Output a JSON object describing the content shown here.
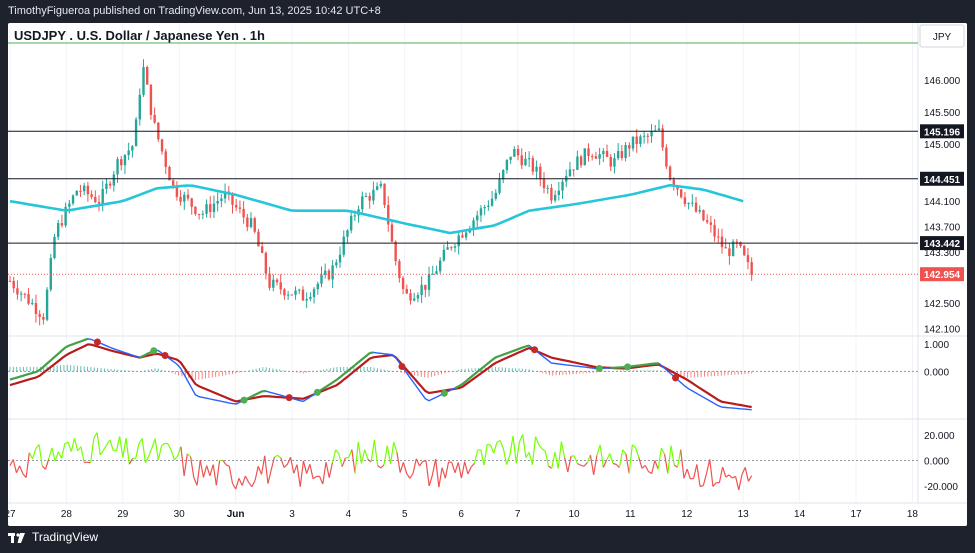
{
  "header": {
    "publisher": "TimothyFigueroa published on TradingView.com, Jun 13, 2025 10:42 UTC+8",
    "symbol_title": "USDJPY . U.S. Dollar / Japanese Yen . 1h",
    "currency": "JPY"
  },
  "footer": {
    "brand": "TradingView"
  },
  "colors": {
    "up": "#26a69a",
    "down": "#ef5350",
    "ma": "#26c6da",
    "bg": "#ffffff",
    "axis_text": "#131722"
  },
  "chart_data": [
    {
      "type": "candlestick",
      "name": "price",
      "ylim": [
        142.0,
        146.55
      ],
      "y_ticks": [
        "146.000",
        "145.500",
        "145.000",
        "144.100",
        "143.700",
        "143.300",
        "142.500",
        "142.100"
      ],
      "price_lines": [
        {
          "value": "145.196",
          "label": "145.196"
        },
        {
          "value": "144.451",
          "label": "144.451"
        },
        {
          "value": "143.442",
          "label": "143.442"
        }
      ],
      "last_price": {
        "value": 142.954,
        "label": "142.954",
        "color": "#ef5350"
      },
      "x_ticks": [
        "27",
        "28",
        "29",
        "30",
        "Jun",
        "3",
        "4",
        "5",
        "6",
        "7",
        "10",
        "11",
        "12",
        "13",
        "14",
        "17",
        "18"
      ],
      "ohlc_keypoints": [
        {
          "t": 0,
          "p": 142.85
        },
        {
          "t": 0.6,
          "p": 142.3
        },
        {
          "t": 0.8,
          "p": 143.6
        },
        {
          "t": 1.2,
          "p": 144.3
        },
        {
          "t": 1.6,
          "p": 144.1
        },
        {
          "t": 1.9,
          "p": 144.7
        },
        {
          "t": 2.2,
          "p": 145.0
        },
        {
          "t": 2.35,
          "p": 146.25
        },
        {
          "t": 2.55,
          "p": 145.3
        },
        {
          "t": 2.9,
          "p": 144.3
        },
        {
          "t": 3.4,
          "p": 143.9
        },
        {
          "t": 3.8,
          "p": 144.2
        },
        {
          "t": 4.3,
          "p": 143.7
        },
        {
          "t": 4.6,
          "p": 142.8
        },
        {
          "t": 5.2,
          "p": 142.6
        },
        {
          "t": 5.7,
          "p": 143.0
        },
        {
          "t": 6.2,
          "p": 144.1
        },
        {
          "t": 6.6,
          "p": 144.3
        },
        {
          "t": 6.8,
          "p": 143.3
        },
        {
          "t": 7.0,
          "p": 142.6
        },
        {
          "t": 7.4,
          "p": 142.8
        },
        {
          "t": 7.8,
          "p": 143.4
        },
        {
          "t": 8.2,
          "p": 143.8
        },
        {
          "t": 8.6,
          "p": 144.2
        },
        {
          "t": 8.9,
          "p": 144.9
        },
        {
          "t": 9.3,
          "p": 144.6
        },
        {
          "t": 9.6,
          "p": 144.2
        },
        {
          "t": 9.9,
          "p": 144.6
        },
        {
          "t": 10.3,
          "p": 144.9
        },
        {
          "t": 10.7,
          "p": 144.7
        },
        {
          "t": 11.0,
          "p": 145.0
        },
        {
          "t": 11.3,
          "p": 145.1
        },
        {
          "t": 11.5,
          "p": 145.2
        },
        {
          "t": 11.7,
          "p": 144.5
        },
        {
          "t": 12.0,
          "p": 144.1
        },
        {
          "t": 12.4,
          "p": 143.7
        },
        {
          "t": 12.7,
          "p": 143.3
        },
        {
          "t": 12.9,
          "p": 143.4
        },
        {
          "t": 13.15,
          "p": 142.95
        }
      ],
      "moving_average": [
        {
          "t": 0,
          "p": 144.1
        },
        {
          "t": 1,
          "p": 143.95
        },
        {
          "t": 2,
          "p": 144.1
        },
        {
          "t": 2.6,
          "p": 144.3
        },
        {
          "t": 3.2,
          "p": 144.35
        },
        {
          "t": 4,
          "p": 144.2
        },
        {
          "t": 5,
          "p": 143.95
        },
        {
          "t": 6,
          "p": 143.95
        },
        {
          "t": 7,
          "p": 143.75
        },
        {
          "t": 7.8,
          "p": 143.6
        },
        {
          "t": 8.6,
          "p": 143.72
        },
        {
          "t": 9.2,
          "p": 143.95
        },
        {
          "t": 10,
          "p": 144.05
        },
        {
          "t": 11,
          "p": 144.2
        },
        {
          "t": 11.7,
          "p": 144.35
        },
        {
          "t": 12.3,
          "p": 144.28
        },
        {
          "t": 13.0,
          "p": 144.1
        }
      ]
    },
    {
      "type": "line",
      "name": "oscillator",
      "ylim": [
        -1.7,
        1.25
      ],
      "y_ticks": [
        "1.000",
        "0.000"
      ],
      "fast": [
        {
          "t": 0,
          "p": -0.3
        },
        {
          "t": 0.5,
          "p": 0.0
        },
        {
          "t": 1.0,
          "p": 0.9
        },
        {
          "t": 1.4,
          "p": 1.2
        },
        {
          "t": 1.8,
          "p": 0.85
        },
        {
          "t": 2.3,
          "p": 0.5
        },
        {
          "t": 2.6,
          "p": 0.8
        },
        {
          "t": 3.0,
          "p": 0.2
        },
        {
          "t": 3.3,
          "p": -0.9
        },
        {
          "t": 4.0,
          "p": -1.2
        },
        {
          "t": 4.5,
          "p": -0.7
        },
        {
          "t": 5.2,
          "p": -1.1
        },
        {
          "t": 5.8,
          "p": -0.3
        },
        {
          "t": 6.4,
          "p": 0.7
        },
        {
          "t": 6.8,
          "p": 0.6
        },
        {
          "t": 7.4,
          "p": -1.1
        },
        {
          "t": 8.0,
          "p": -0.5
        },
        {
          "t": 8.6,
          "p": 0.5
        },
        {
          "t": 9.2,
          "p": 0.95
        },
        {
          "t": 9.6,
          "p": 0.3
        },
        {
          "t": 10.4,
          "p": 0.1
        },
        {
          "t": 10.9,
          "p": 0.15
        },
        {
          "t": 11.5,
          "p": 0.3
        },
        {
          "t": 12.0,
          "p": -0.6
        },
        {
          "t": 12.6,
          "p": -1.3
        },
        {
          "t": 13.15,
          "p": -1.4
        }
      ],
      "slow": [
        {
          "t": 0,
          "p": -0.5
        },
        {
          "t": 0.5,
          "p": -0.2
        },
        {
          "t": 1.0,
          "p": 0.6
        },
        {
          "t": 1.4,
          "p": 1.0
        },
        {
          "t": 1.8,
          "p": 0.75
        },
        {
          "t": 2.3,
          "p": 0.5
        },
        {
          "t": 2.6,
          "p": 0.65
        },
        {
          "t": 3.0,
          "p": 0.4
        },
        {
          "t": 3.3,
          "p": -0.5
        },
        {
          "t": 4.0,
          "p": -1.1
        },
        {
          "t": 4.5,
          "p": -0.9
        },
        {
          "t": 5.2,
          "p": -1.0
        },
        {
          "t": 5.8,
          "p": -0.5
        },
        {
          "t": 6.4,
          "p": 0.5
        },
        {
          "t": 6.8,
          "p": 0.6
        },
        {
          "t": 7.4,
          "p": -0.8
        },
        {
          "t": 8.0,
          "p": -0.6
        },
        {
          "t": 8.6,
          "p": 0.3
        },
        {
          "t": 9.2,
          "p": 0.85
        },
        {
          "t": 9.6,
          "p": 0.5
        },
        {
          "t": 10.4,
          "p": 0.15
        },
        {
          "t": 10.9,
          "p": 0.1
        },
        {
          "t": 11.5,
          "p": 0.25
        },
        {
          "t": 12.0,
          "p": -0.3
        },
        {
          "t": 12.6,
          "p": -1.1
        },
        {
          "t": 13.15,
          "p": -1.3
        }
      ],
      "cross_up": [
        2.55,
        4.15,
        5.45,
        7.7,
        10.45,
        10.95
      ],
      "cross_down": [
        1.55,
        2.75,
        4.95,
        6.95,
        9.3,
        11.8
      ]
    },
    {
      "type": "line",
      "name": "momentum",
      "ylim": [
        -32,
        32
      ],
      "y_ticks": [
        "20.000",
        "0.000",
        "-20.000"
      ],
      "zero_line": 0
    }
  ]
}
